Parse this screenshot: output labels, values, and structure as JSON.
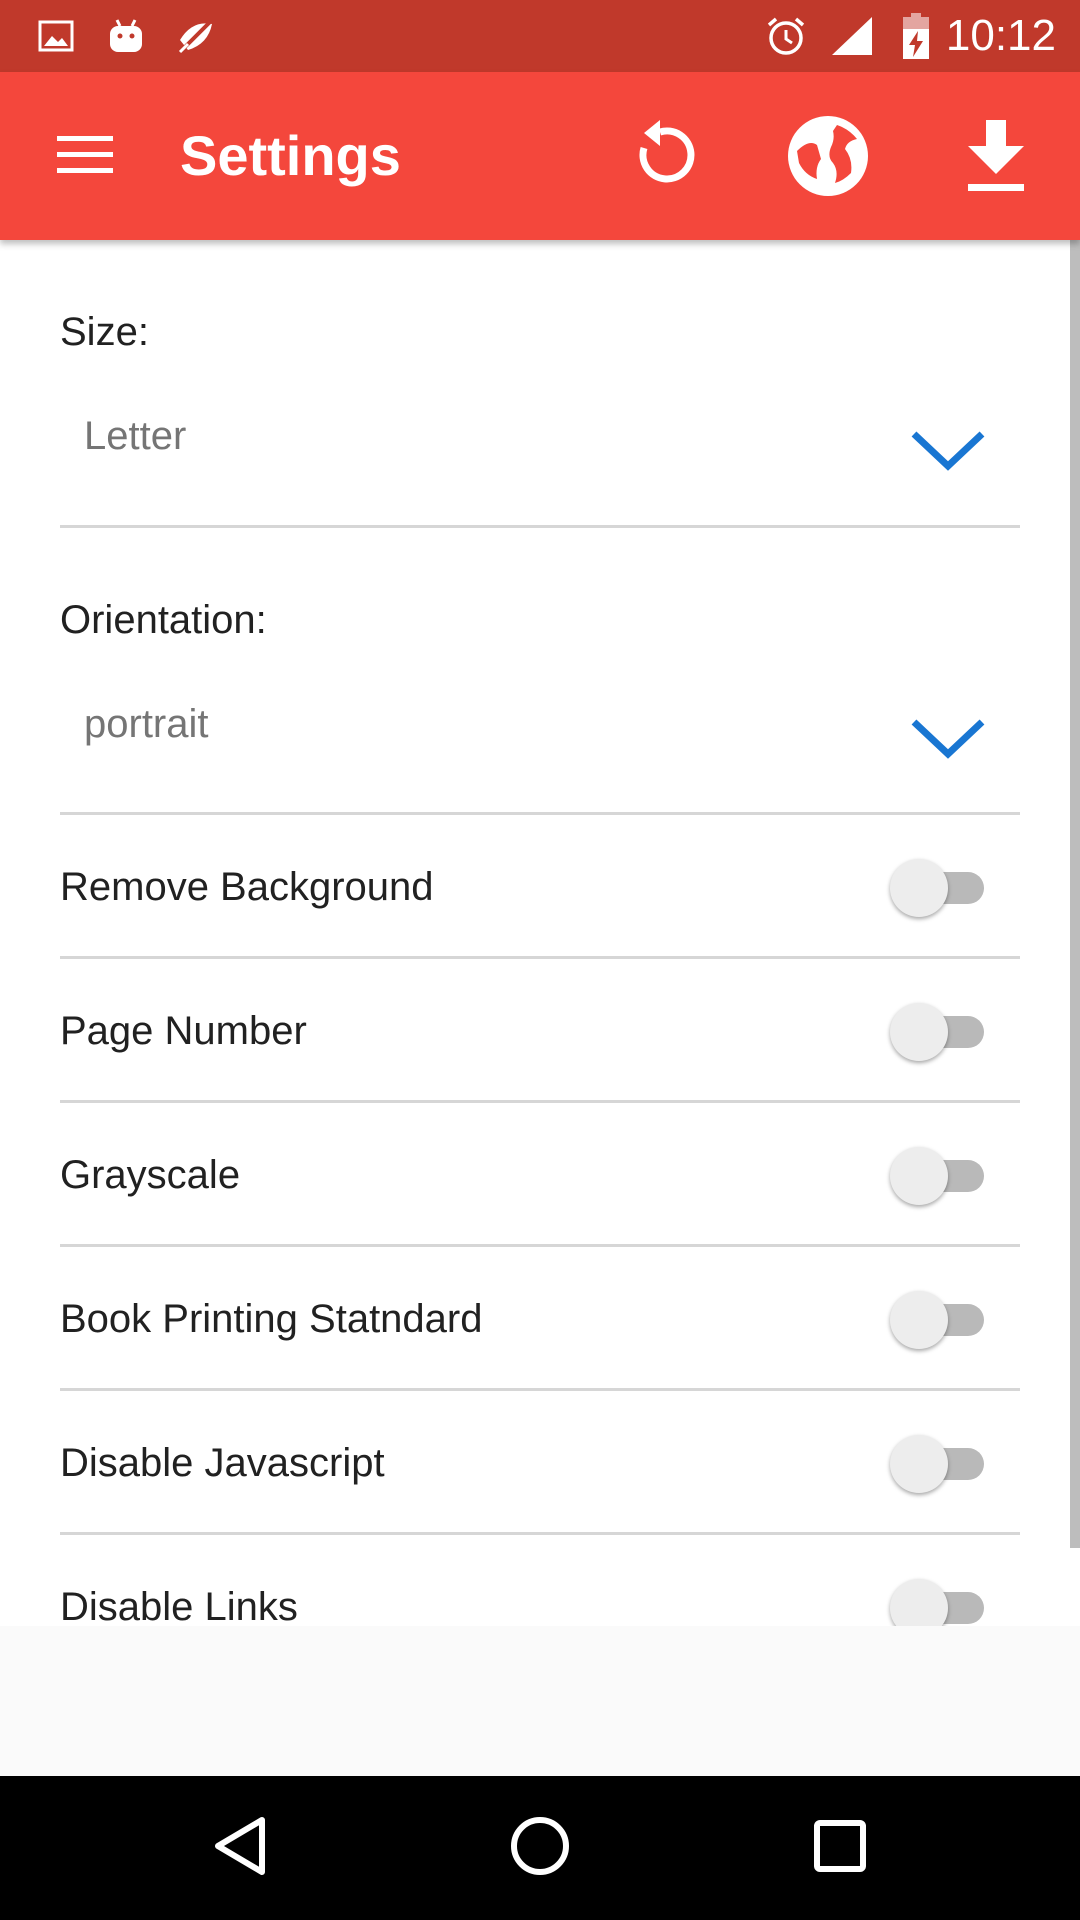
{
  "status_bar": {
    "time": "10:12",
    "left_icons": [
      "image-icon",
      "android-debug-icon",
      "satellite-icon"
    ],
    "right_icons": [
      "alarm-icon",
      "signal-icon",
      "battery-charging-icon"
    ]
  },
  "app_bar": {
    "title": "Settings",
    "actions": [
      "refresh-icon",
      "globe-icon",
      "download-icon"
    ]
  },
  "settings": {
    "size": {
      "label": "Size:",
      "value": "Letter"
    },
    "orientation": {
      "label": "Orientation:",
      "value": "portrait"
    },
    "toggles": [
      {
        "label": "Remove Background",
        "on": false
      },
      {
        "label": "Page Number",
        "on": false
      },
      {
        "label": "Grayscale",
        "on": false
      },
      {
        "label": "Book Printing Statndard",
        "on": false
      },
      {
        "label": "Disable Javascript",
        "on": false
      },
      {
        "label": "Disable Links",
        "on": false
      }
    ]
  },
  "nav_bar": {
    "buttons": [
      "back-icon",
      "home-icon",
      "recents-icon"
    ]
  },
  "colors": {
    "status_bar": "#c0392b",
    "app_bar": "#f4473c",
    "accent": "#1976d2"
  }
}
